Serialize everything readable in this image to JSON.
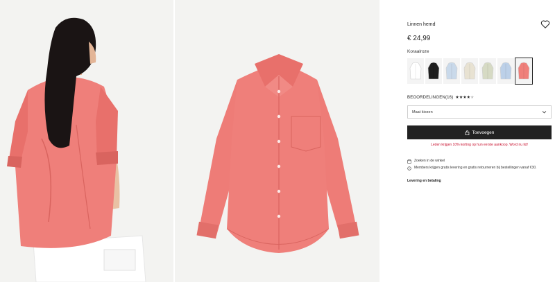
{
  "product": {
    "title": "Linnen hemd",
    "price": "€ 24,99",
    "color_name": "Koraalroze",
    "swatches": [
      {
        "name": "wit",
        "color": "#ffffff"
      },
      {
        "name": "zwart",
        "color": "#1e1e1e"
      },
      {
        "name": "lichtblauw",
        "color": "#c9d9ea"
      },
      {
        "name": "beige",
        "color": "#e8e2d2"
      },
      {
        "name": "saliegroen",
        "color": "#d6dac4"
      },
      {
        "name": "blauw",
        "color": "#bcd0e8"
      },
      {
        "name": "koraalroze",
        "color": "#ef7f7a",
        "selected": true
      }
    ],
    "reviews_label": "BEOORDELINGEN(16)",
    "rating": 4,
    "rating_max": 5,
    "size_placeholder": "Maat kiezen",
    "add_button": "Toevoegen",
    "promo_text": "Leden krijgen 10% korting op hun eerste aankoop. Word nu lid!",
    "store_search": "Zoeken in de winkel",
    "members_info": "Members krijgen gratis levering en gratis retourneren bij bestellingen vanaf €30.",
    "delivery_link": "Levering en betaling"
  },
  "colors": {
    "shirt": "#ef7f7a",
    "shirt_shadow": "#d9645f",
    "button_dark": "#222222",
    "promo_red": "#c8102e"
  },
  "icons": {
    "favorite": "heart-icon",
    "dropdown": "chevron-down-icon",
    "bag": "bag-icon",
    "store": "store-icon",
    "info": "info-icon"
  }
}
